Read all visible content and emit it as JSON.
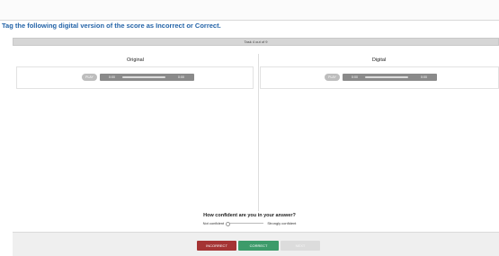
{
  "header": {
    "title": "Tag the following digital version of the score as Incorrect or Correct.",
    "task_progress": "Task 4 out of 9"
  },
  "panels": [
    {
      "title": "Original",
      "player": {
        "play_label": "PLAY",
        "current_time": "0:00",
        "total_time": "0:00"
      }
    },
    {
      "title": "Digital",
      "player": {
        "play_label": "PLAY",
        "current_time": "0:00",
        "total_time": "0:00"
      }
    }
  ],
  "confidence": {
    "question": "How confident are you in your answer?",
    "min_label": "Not confident",
    "max_label": "Strongly confident"
  },
  "actions": {
    "incorrect_label": "INCORRECT",
    "correct_label": "CORRECT",
    "next_label": "NEXT"
  },
  "colors": {
    "title": "#2464a8",
    "incorrect": "#a53434",
    "correct": "#3d9b6a",
    "next_disabled": "#dcdcdc",
    "player_bar": "#8a8a8a"
  }
}
